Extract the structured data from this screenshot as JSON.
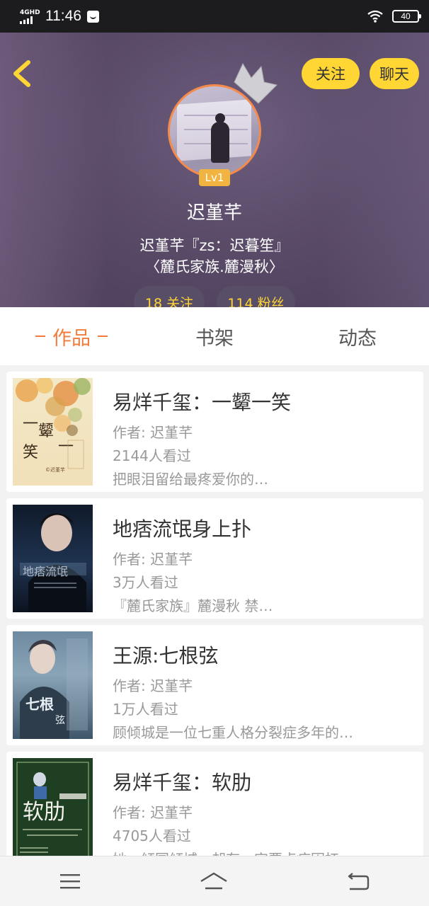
{
  "status_bar": {
    "network": "4GHD",
    "time": "11:46",
    "battery": "40"
  },
  "header": {
    "follow_label": "关注",
    "chat_label": "聊天",
    "level": "Lv1",
    "nickname": "迟堇芊",
    "bio": "迟堇芊『zs：迟暮笙』\n〈麓氏家族.麓漫秋〉",
    "following": "18 关注",
    "fans": "114 粉丝"
  },
  "tabs": [
    {
      "label": "作品",
      "active": true
    },
    {
      "label": "书架",
      "active": false
    },
    {
      "label": "动态",
      "active": false
    }
  ],
  "books": [
    {
      "title": "易烊千玺：一颦一笑",
      "author": "作者: 迟堇芊",
      "views": "2144人看过",
      "desc": "把眼泪留给最疼爱你的…",
      "cover_text": "一颦一笑"
    },
    {
      "title": "地痞流氓身上扑",
      "author": "作者: 迟堇芊",
      "views": "3万人看过",
      "desc": "『麓氏家族』麓漫秋 禁…",
      "cover_text": ""
    },
    {
      "title": "王源:七根弦",
      "author": "作者: 迟堇芊",
      "views": "1万人看过",
      "desc": "顾倾城是一位七重人格分裂症多年的…",
      "cover_text": "七根弦"
    },
    {
      "title": "易烊千玺：软肋",
      "author": "作者: 迟堇芊",
      "views": "4705人看过",
      "desc": "她，倾国倾城，却有一定要点病因扛…",
      "cover_text": "软肋"
    }
  ],
  "nav": {
    "menu_icon": "menu-icon",
    "home_icon": "home-icon",
    "back_icon": "back-icon"
  },
  "colors": {
    "accent": "#f37b3c",
    "button_yellow": "#ffd633",
    "stat_text": "#ffd633"
  }
}
